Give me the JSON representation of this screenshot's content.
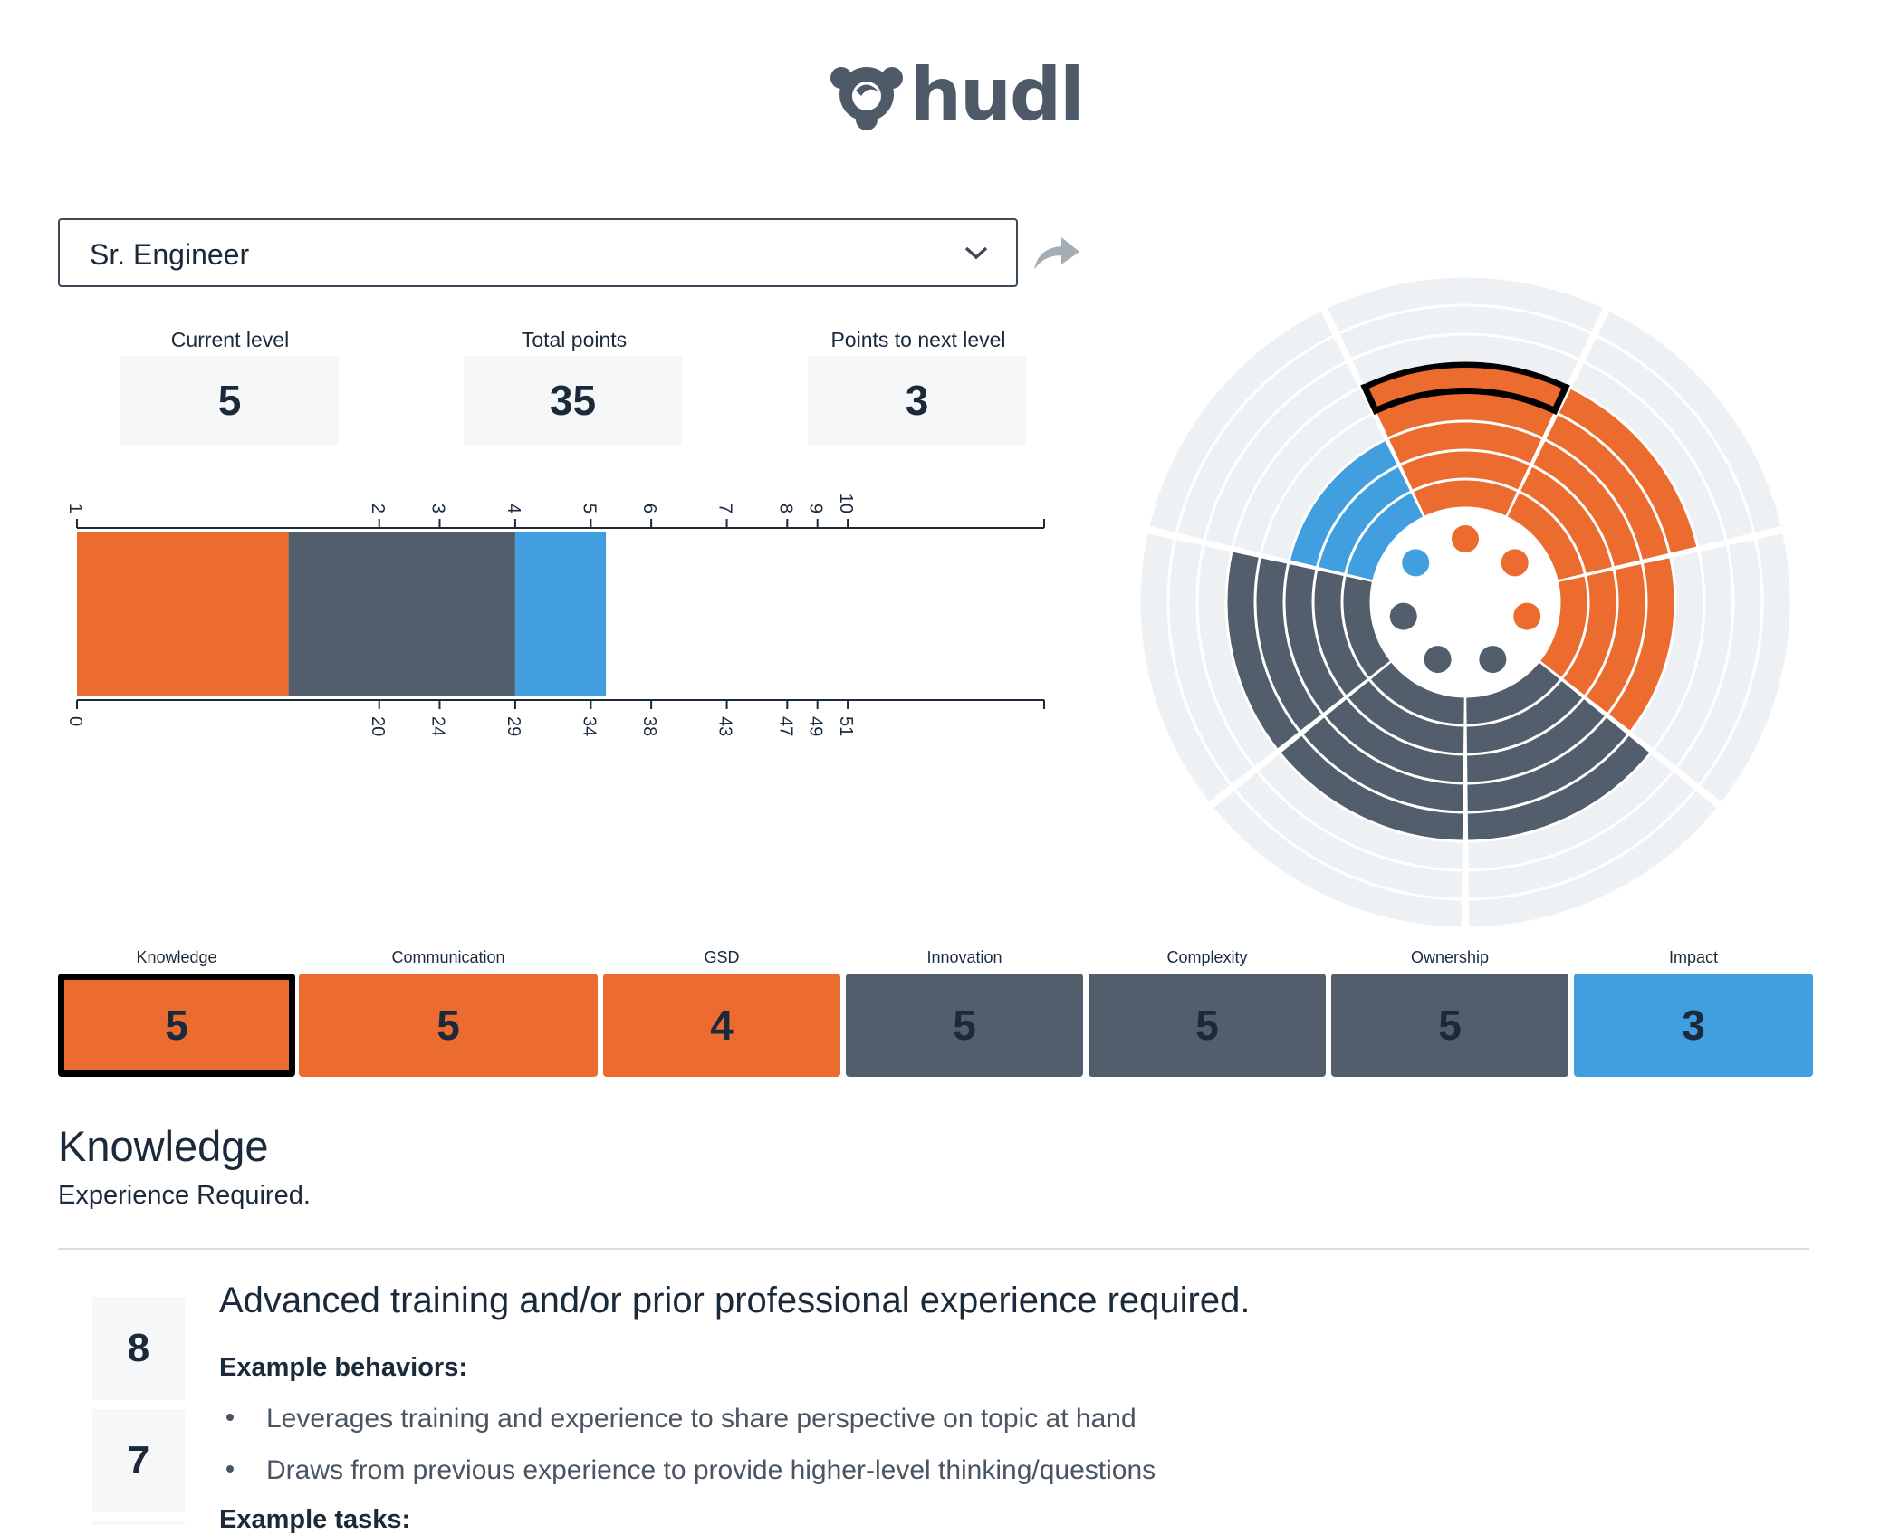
{
  "brand": {
    "name": "hudl",
    "logo_icon": "hudl-logo-icon"
  },
  "role_select": {
    "value": "Sr. Engineer",
    "icon": "chevron-down-icon"
  },
  "share": {
    "icon": "share-arrow-icon"
  },
  "stats": [
    {
      "label": "Current level",
      "value": "5"
    },
    {
      "label": "Total points",
      "value": "35"
    },
    {
      "label": "Points to next level",
      "value": "3"
    }
  ],
  "chart_data": [
    {
      "type": "bar",
      "orientation": "horizontal-stacked",
      "title": "",
      "level_ticks": [
        {
          "level": "1",
          "points": "0"
        },
        {
          "level": "2",
          "points": "20"
        },
        {
          "level": "3",
          "points": "24"
        },
        {
          "level": "4",
          "points": "29"
        },
        {
          "level": "5",
          "points": "34"
        },
        {
          "level": "6",
          "points": "38"
        },
        {
          "level": "7",
          "points": "43"
        },
        {
          "level": "8",
          "points": "47"
        },
        {
          "level": "9",
          "points": "49"
        },
        {
          "level": "10",
          "points": "51"
        }
      ],
      "xlim": [
        0,
        64
      ],
      "segments": [
        {
          "color": "#ec6b2f",
          "start": 0,
          "end": 14
        },
        {
          "color": "#525e6b",
          "start": 14,
          "end": 29
        },
        {
          "color": "#429fdf",
          "start": 29,
          "end": 35
        }
      ]
    },
    {
      "type": "radial",
      "max_level": 8,
      "categories": [
        "Knowledge",
        "Communication",
        "GSD",
        "Innovation",
        "Complexity",
        "Ownership",
        "Impact"
      ],
      "values": [
        5,
        5,
        4,
        5,
        5,
        5,
        3
      ],
      "colors": [
        "#ec6b2f",
        "#ec6b2f",
        "#ec6b2f",
        "#525e6b",
        "#525e6b",
        "#525e6b",
        "#429fdf"
      ],
      "highlighted": "Knowledge",
      "highlighted_level": 5
    }
  ],
  "categories": [
    {
      "label": "Knowledge",
      "value": "5",
      "color": "#ec6b2f",
      "selected": true
    },
    {
      "label": "Communication",
      "value": "5",
      "color": "#ec6b2f"
    },
    {
      "label": "GSD",
      "value": "4",
      "color": "#ec6b2f"
    },
    {
      "label": "Innovation",
      "value": "5",
      "color": "#525e6b"
    },
    {
      "label": "Complexity",
      "value": "5",
      "color": "#525e6b"
    },
    {
      "label": "Ownership",
      "value": "5",
      "color": "#525e6b"
    },
    {
      "label": "Impact",
      "value": "3",
      "color": "#429fdf"
    }
  ],
  "section": {
    "title": "Knowledge",
    "subtitle": "Experience Required.",
    "levels": [
      "8",
      "7"
    ],
    "level_description": "Advanced training and/or prior professional experience required.",
    "behaviors_heading": "Example behaviors:",
    "behaviors": [
      "Leverages training and experience to share perspective on topic at hand",
      "Draws from previous experience to provide higher-level thinking/questions"
    ],
    "tasks_heading": "Example tasks:"
  }
}
